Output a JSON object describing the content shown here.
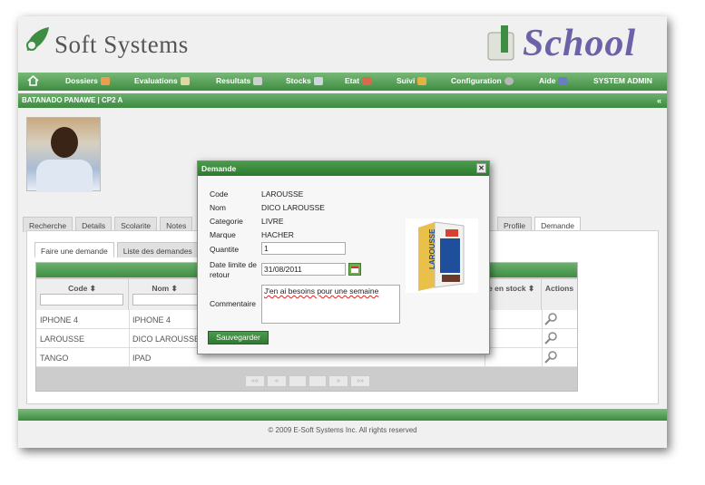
{
  "header": {
    "company": "Soft Systems",
    "app": "School"
  },
  "nav": {
    "items": [
      "Dossiers",
      "Evaluations",
      "Resultats",
      "Stocks",
      "Etat",
      "Suivi",
      "Configuration",
      "Aide"
    ],
    "user": "SYSTEM ADMIN"
  },
  "student": {
    "title": "BATANADO PANAWE | CP2 A"
  },
  "tabs": [
    "Recherche",
    "Details",
    "Scolarite",
    "Notes",
    "Profile",
    "Demande"
  ],
  "subtabs": [
    "Faire une demande",
    "Liste des demandes"
  ],
  "grid": {
    "columns": {
      "code": "Code",
      "nom": "Nom",
      "stock": "e en stock",
      "actions": "Actions"
    },
    "rows": [
      {
        "code": "IPHONE 4",
        "nom": "IPHONE 4"
      },
      {
        "code": "LAROUSSE",
        "nom": "DICO LAROUSSE"
      },
      {
        "code": "TANGO",
        "nom": "IPAD"
      }
    ]
  },
  "modal": {
    "title": "Demande",
    "labels": {
      "code": "Code",
      "nom": "Nom",
      "categorie": "Categorie",
      "marque": "Marque",
      "quantite": "Quantite",
      "date": "Date limite de retour",
      "commentaire": "Commentaire"
    },
    "values": {
      "code": "LAROUSSE",
      "nom": "DICO LAROUSSE",
      "categorie": "LIVRE",
      "marque": "HACHER",
      "quantite": "1",
      "date": "31/08/2011",
      "commentaire": "J'en ai besoins pour une semaine"
    },
    "save": "Sauvegarder",
    "book_text": "LAROUSSE"
  },
  "footer": "© 2009 E-Soft Systems Inc. All rights reserved",
  "colors": {
    "green": "#3f8d42",
    "school_purple": "#6b62a8"
  }
}
